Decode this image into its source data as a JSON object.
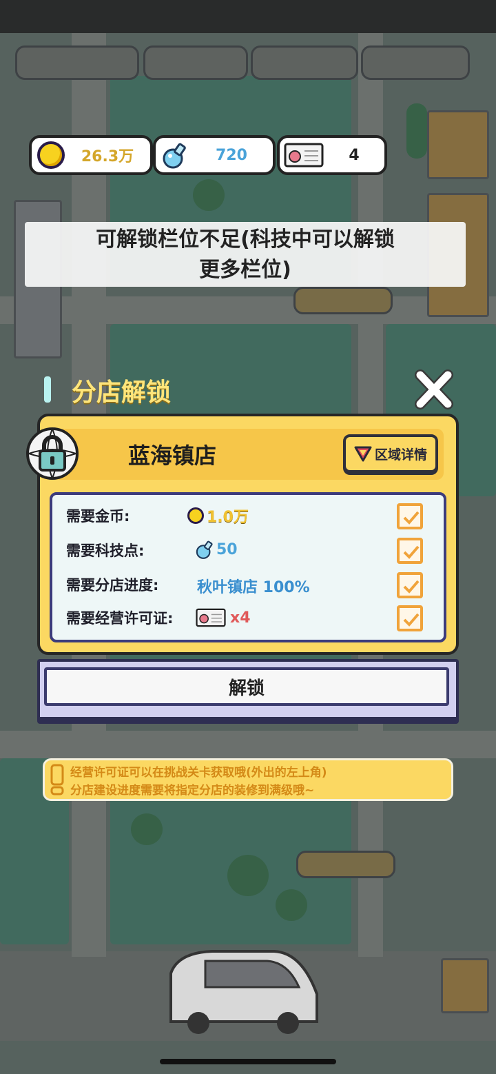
{
  "resources": {
    "coins": "26.3万",
    "tech": "720",
    "licenses": "4"
  },
  "toast": {
    "line1": "可解锁栏位不足(科技中可以解锁",
    "line2": "更多栏位)"
  },
  "dialog": {
    "title": "分店解锁",
    "shop_name": "蓝海镇店",
    "detail_button": "区域详情",
    "requirements": [
      {
        "label": "需要金币:",
        "value": "1.0万",
        "icon": "coin-icon",
        "met": true
      },
      {
        "label": "需要科技点:",
        "value": "50",
        "icon": "flask-icon",
        "met": true
      },
      {
        "label": "需要分店进度:",
        "value": "秋叶镇店 100%",
        "icon": "",
        "met": true
      },
      {
        "label": "需要经营许可证:",
        "value": "x4",
        "icon": "license-icon",
        "met": true
      }
    ],
    "unlock_button": "解锁"
  },
  "tips": {
    "line1": "经营许可证可以在挑战关卡获取哦(外出的左上角)",
    "line2": "分店建设进度需要将指定分店的装修到满级哦~"
  },
  "colors": {
    "gold_text": "#d4a62a",
    "tech_text": "#4aa3d9",
    "progress_text": "#3a8fcf",
    "license_text": "#e05a5a",
    "check": "#f0a33a",
    "card_yellow": "#fbd862"
  }
}
